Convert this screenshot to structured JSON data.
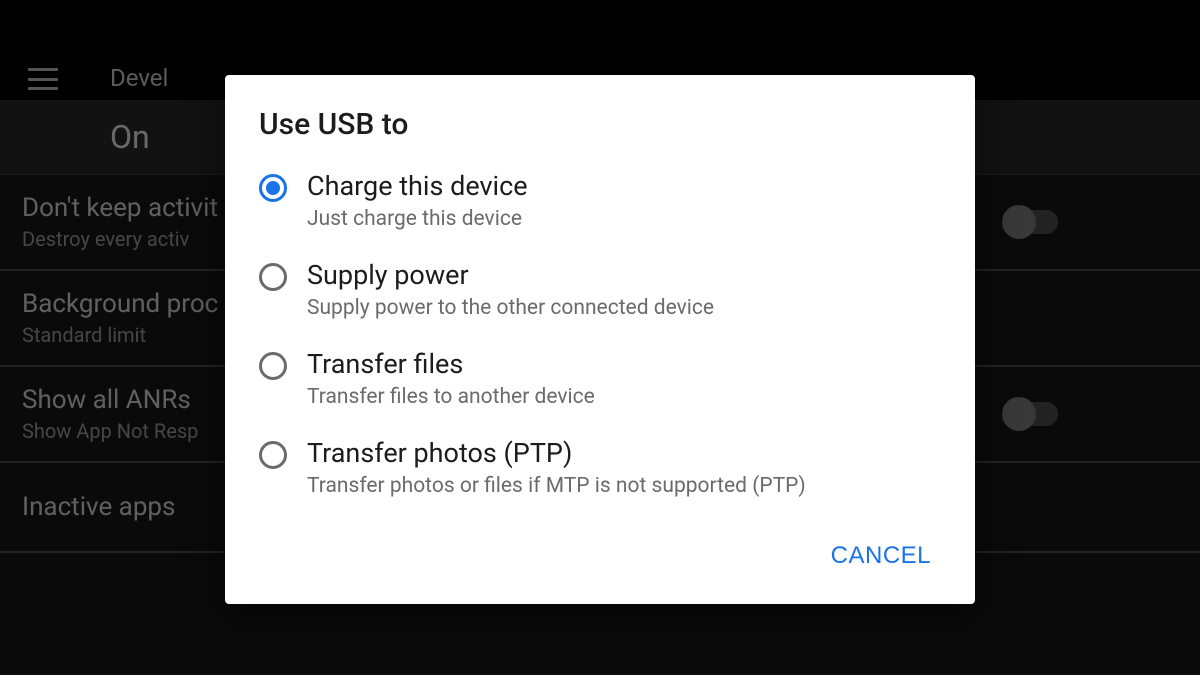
{
  "bg": {
    "title": "Devel",
    "on_label": "On",
    "rows": [
      {
        "primary": "Don't keep activit",
        "secondary": "Destroy every activ",
        "toggle": true
      },
      {
        "primary": "Background proc",
        "secondary": "Standard limit",
        "toggle": false
      },
      {
        "primary": "Show all ANRs",
        "secondary": "Show App Not Resp",
        "toggle": true
      },
      {
        "primary": "Inactive apps",
        "secondary": "",
        "toggle": false
      }
    ]
  },
  "dialog": {
    "title": "Use USB to",
    "options": [
      {
        "label": "Charge this device",
        "desc": "Just charge this device",
        "selected": true
      },
      {
        "label": "Supply power",
        "desc": "Supply power to the other connected device",
        "selected": false
      },
      {
        "label": "Transfer files",
        "desc": "Transfer files to another device",
        "selected": false
      },
      {
        "label": "Transfer photos (PTP)",
        "desc": "Transfer photos or files if MTP is not supported (PTP)",
        "selected": false
      }
    ],
    "cancel": "CANCEL"
  }
}
